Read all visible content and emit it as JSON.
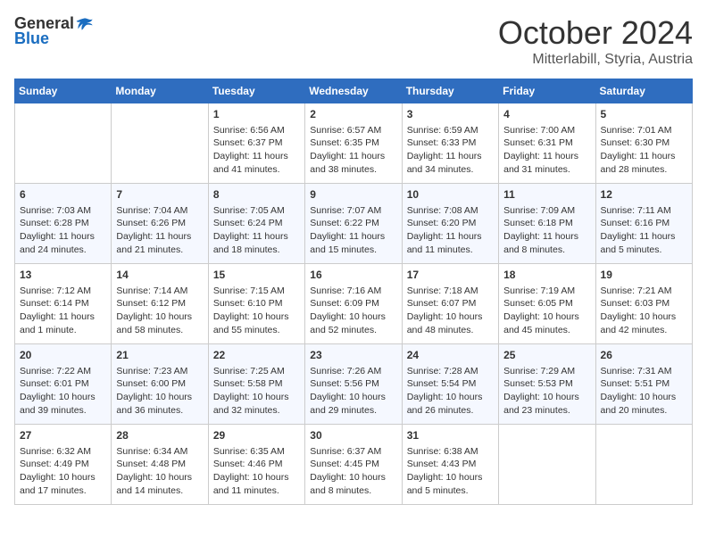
{
  "header": {
    "logo_general": "General",
    "logo_blue": "Blue",
    "title": "October 2024",
    "subtitle": "Mitterlabill, Styria, Austria"
  },
  "weekdays": [
    "Sunday",
    "Monday",
    "Tuesday",
    "Wednesday",
    "Thursday",
    "Friday",
    "Saturday"
  ],
  "weeks": [
    [
      {
        "day": "",
        "info": ""
      },
      {
        "day": "",
        "info": ""
      },
      {
        "day": "1",
        "info": "Sunrise: 6:56 AM\nSunset: 6:37 PM\nDaylight: 11 hours and 41 minutes."
      },
      {
        "day": "2",
        "info": "Sunrise: 6:57 AM\nSunset: 6:35 PM\nDaylight: 11 hours and 38 minutes."
      },
      {
        "day": "3",
        "info": "Sunrise: 6:59 AM\nSunset: 6:33 PM\nDaylight: 11 hours and 34 minutes."
      },
      {
        "day": "4",
        "info": "Sunrise: 7:00 AM\nSunset: 6:31 PM\nDaylight: 11 hours and 31 minutes."
      },
      {
        "day": "5",
        "info": "Sunrise: 7:01 AM\nSunset: 6:30 PM\nDaylight: 11 hours and 28 minutes."
      }
    ],
    [
      {
        "day": "6",
        "info": "Sunrise: 7:03 AM\nSunset: 6:28 PM\nDaylight: 11 hours and 24 minutes."
      },
      {
        "day": "7",
        "info": "Sunrise: 7:04 AM\nSunset: 6:26 PM\nDaylight: 11 hours and 21 minutes."
      },
      {
        "day": "8",
        "info": "Sunrise: 7:05 AM\nSunset: 6:24 PM\nDaylight: 11 hours and 18 minutes."
      },
      {
        "day": "9",
        "info": "Sunrise: 7:07 AM\nSunset: 6:22 PM\nDaylight: 11 hours and 15 minutes."
      },
      {
        "day": "10",
        "info": "Sunrise: 7:08 AM\nSunset: 6:20 PM\nDaylight: 11 hours and 11 minutes."
      },
      {
        "day": "11",
        "info": "Sunrise: 7:09 AM\nSunset: 6:18 PM\nDaylight: 11 hours and 8 minutes."
      },
      {
        "day": "12",
        "info": "Sunrise: 7:11 AM\nSunset: 6:16 PM\nDaylight: 11 hours and 5 minutes."
      }
    ],
    [
      {
        "day": "13",
        "info": "Sunrise: 7:12 AM\nSunset: 6:14 PM\nDaylight: 11 hours and 1 minute."
      },
      {
        "day": "14",
        "info": "Sunrise: 7:14 AM\nSunset: 6:12 PM\nDaylight: 10 hours and 58 minutes."
      },
      {
        "day": "15",
        "info": "Sunrise: 7:15 AM\nSunset: 6:10 PM\nDaylight: 10 hours and 55 minutes."
      },
      {
        "day": "16",
        "info": "Sunrise: 7:16 AM\nSunset: 6:09 PM\nDaylight: 10 hours and 52 minutes."
      },
      {
        "day": "17",
        "info": "Sunrise: 7:18 AM\nSunset: 6:07 PM\nDaylight: 10 hours and 48 minutes."
      },
      {
        "day": "18",
        "info": "Sunrise: 7:19 AM\nSunset: 6:05 PM\nDaylight: 10 hours and 45 minutes."
      },
      {
        "day": "19",
        "info": "Sunrise: 7:21 AM\nSunset: 6:03 PM\nDaylight: 10 hours and 42 minutes."
      }
    ],
    [
      {
        "day": "20",
        "info": "Sunrise: 7:22 AM\nSunset: 6:01 PM\nDaylight: 10 hours and 39 minutes."
      },
      {
        "day": "21",
        "info": "Sunrise: 7:23 AM\nSunset: 6:00 PM\nDaylight: 10 hours and 36 minutes."
      },
      {
        "day": "22",
        "info": "Sunrise: 7:25 AM\nSunset: 5:58 PM\nDaylight: 10 hours and 32 minutes."
      },
      {
        "day": "23",
        "info": "Sunrise: 7:26 AM\nSunset: 5:56 PM\nDaylight: 10 hours and 29 minutes."
      },
      {
        "day": "24",
        "info": "Sunrise: 7:28 AM\nSunset: 5:54 PM\nDaylight: 10 hours and 26 minutes."
      },
      {
        "day": "25",
        "info": "Sunrise: 7:29 AM\nSunset: 5:53 PM\nDaylight: 10 hours and 23 minutes."
      },
      {
        "day": "26",
        "info": "Sunrise: 7:31 AM\nSunset: 5:51 PM\nDaylight: 10 hours and 20 minutes."
      }
    ],
    [
      {
        "day": "27",
        "info": "Sunrise: 6:32 AM\nSunset: 4:49 PM\nDaylight: 10 hours and 17 minutes."
      },
      {
        "day": "28",
        "info": "Sunrise: 6:34 AM\nSunset: 4:48 PM\nDaylight: 10 hours and 14 minutes."
      },
      {
        "day": "29",
        "info": "Sunrise: 6:35 AM\nSunset: 4:46 PM\nDaylight: 10 hours and 11 minutes."
      },
      {
        "day": "30",
        "info": "Sunrise: 6:37 AM\nSunset: 4:45 PM\nDaylight: 10 hours and 8 minutes."
      },
      {
        "day": "31",
        "info": "Sunrise: 6:38 AM\nSunset: 4:43 PM\nDaylight: 10 hours and 5 minutes."
      },
      {
        "day": "",
        "info": ""
      },
      {
        "day": "",
        "info": ""
      }
    ]
  ]
}
